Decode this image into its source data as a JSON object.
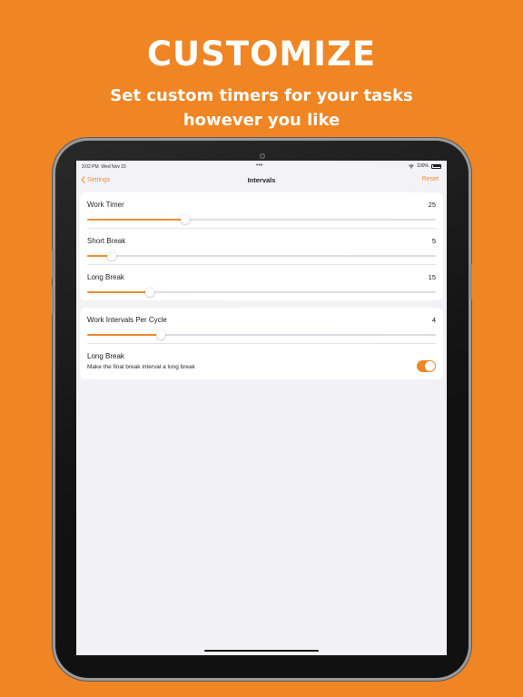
{
  "promo": {
    "title": "CUSTOMIZE",
    "subtitle_line1": "Set custom timers for your tasks",
    "subtitle_line2": "however you like"
  },
  "status_bar": {
    "time": "3:02 PM",
    "date": "Wed Nov 15",
    "dots": "•••",
    "battery": "100%"
  },
  "nav": {
    "back_label": "Settings",
    "title": "Intervals",
    "reset_label": "Reset"
  },
  "intervals": [
    {
      "label": "Work Timer",
      "value": "25",
      "fill_fraction": 0.28
    },
    {
      "label": "Short Break",
      "value": "5",
      "fill_fraction": 0.07
    },
    {
      "label": "Long Break",
      "value": "15",
      "fill_fraction": 0.18
    }
  ],
  "cycle": {
    "label": "Work Intervals Per Cycle",
    "value": "4",
    "fill_fraction": 0.21
  },
  "long_break_toggle": {
    "label": "Long Break",
    "description": "Make the final break interval a long break",
    "enabled": true
  },
  "colors": {
    "accent": "#F08524",
    "background": "#F2F2F6",
    "track": "#DCDCE0"
  }
}
